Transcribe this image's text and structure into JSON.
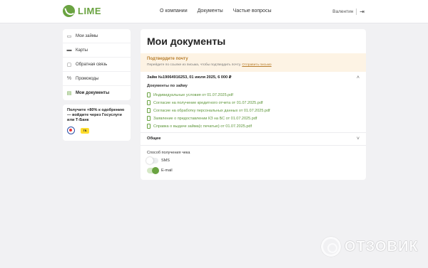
{
  "brand": {
    "name": "LIME",
    "accent": "#6aa341"
  },
  "header": {
    "nav": [
      "О компании",
      "Документы",
      "Частые вопросы"
    ],
    "user_name": "Валентин"
  },
  "sidebar": {
    "items": [
      {
        "label": "Мои займы",
        "icon": "loan-icon"
      },
      {
        "label": "Карты",
        "icon": "card-icon"
      },
      {
        "label": "Обратная связь",
        "icon": "chat-icon"
      },
      {
        "label": "Промокоды",
        "icon": "percent-icon"
      },
      {
        "label": "Мои документы",
        "icon": "documents-icon",
        "active": true
      }
    ]
  },
  "promo": {
    "text": "Получите +80% к одобрению — войдите через Госуслуги или Т-Банк",
    "tbank_label": "ТБ"
  },
  "main": {
    "title": "Мои документы",
    "notice": {
      "title": "Подтвердите почту",
      "text": "Перейдите по ссылке из письма, чтобы подтвердить почту.",
      "link": "Отправить письмо"
    },
    "loan": {
      "header": "Займ №19064916253, 01 июля 2025, 6 000 ₽",
      "docs_label": "Документы по займу",
      "documents": [
        "Индивидуальные условия от 01.07.2025.pdf",
        "Согласие на получение кредитного отчета от 01.07.2025.pdf",
        "Согласие на обработку персональных данных от 01.07.2025.pdf",
        "Заявление о предоставлении КЗ на БС от 01.07.2025.pdf",
        "Справка о выдаче займа(с печатью) от 01.07.2025.pdf"
      ]
    },
    "general": {
      "title": "Общее",
      "method_label": "Способ получения чека",
      "options": [
        {
          "label": "SMS",
          "on": false
        },
        {
          "label": "E-mail",
          "on": true
        }
      ]
    }
  },
  "watermark": {
    "text": "ОТЗОВИК"
  }
}
